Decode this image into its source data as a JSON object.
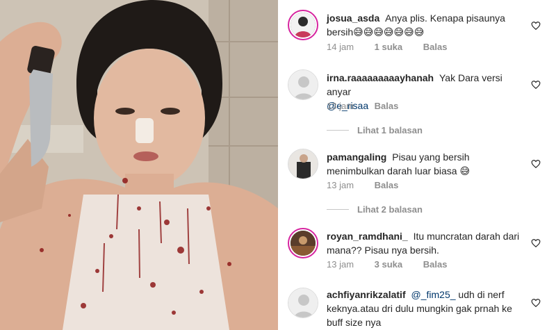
{
  "comments": [
    {
      "username": "josua_asda",
      "text": "Anya plis. Kenapa pisaunya bersih",
      "emojis": "😅😅😅😅😅😅😅",
      "time": "14 jam",
      "likes": "1 suka",
      "reply": "Balas"
    },
    {
      "username": "irna.raaaaaaaaayhanah",
      "text": "Yak Dara versi anyar",
      "mention": "@e_risaa",
      "time": "13 jam",
      "reply": "Balas",
      "view_replies": "Lihat 1 balasan"
    },
    {
      "username": "pamangaling",
      "text": "Pisau yang bersih menimbulkan darah luar biasa",
      "emojis": "😅",
      "time": "13 jam",
      "reply": "Balas",
      "view_replies": "Lihat 2 balasan"
    },
    {
      "username": "royan_ramdhani_",
      "text": "Itu muncratan darah dari mana?? Pisau nya bersih.",
      "time": "13 jam",
      "likes": "3 suka",
      "reply": "Balas"
    },
    {
      "username": "achfiyanrikzalatif",
      "mention": "@_fim25_",
      "text": "udh di nerf keknya.atau dri dulu mungkin gak prnah ke buff size nya"
    }
  ],
  "icons": {
    "like": "heart-outline-icon"
  },
  "colors": {
    "username": "#262626",
    "meta": "#8e8e8e",
    "mention": "#00376b",
    "story_ring": "#d6249f"
  }
}
